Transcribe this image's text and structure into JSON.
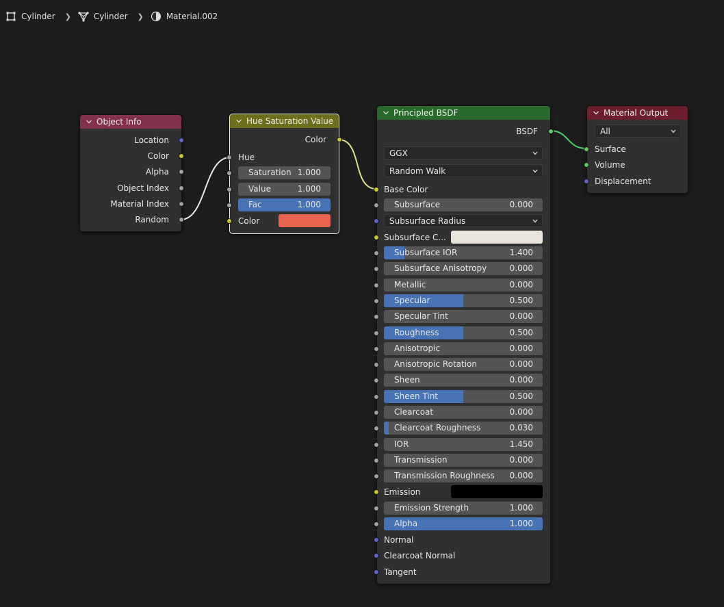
{
  "breadcrumb": {
    "object": "Cylinder",
    "mesh": "Cylinder",
    "material": "Material.002"
  },
  "object_info": {
    "title": "Object Info",
    "header_color": "#83314a",
    "outputs": [
      "Location",
      "Color",
      "Alpha",
      "Object Index",
      "Material Index",
      "Random"
    ]
  },
  "hsv": {
    "title": "Hue Saturation Value",
    "header_color": "#6e6e1d",
    "output": "Color",
    "hue": "Hue",
    "saturation": {
      "label": "Saturation",
      "value": "1.000"
    },
    "value": {
      "label": "Value",
      "value": "1.000"
    },
    "fac": {
      "label": "Fac",
      "value": "1.000",
      "fill": 1.0
    },
    "color_label": "Color",
    "color_swatch": "#e8634e"
  },
  "bsdf": {
    "title": "Principled BSDF",
    "header_color": "#286a2c",
    "output": "BSDF",
    "distribution": "GGX",
    "subsurface_method": "Random Walk",
    "base_color": "Base Color",
    "subsurface": {
      "label": "Subsurface",
      "value": "0.000",
      "fill": 0
    },
    "subsurface_radius": "Subsurface Radius",
    "subsurface_color": {
      "label": "Subsurface C...",
      "swatch": "#e9e4db"
    },
    "params": [
      {
        "label": "Subsurface IOR",
        "value": "1.400",
        "fill": 0.13
      },
      {
        "label": "Subsurface Anisotropy",
        "value": "0.000",
        "fill": 0
      },
      {
        "label": "Metallic",
        "value": "0.000",
        "fill": 0
      },
      {
        "label": "Specular",
        "value": "0.500",
        "fill": 0.5
      },
      {
        "label": "Specular Tint",
        "value": "0.000",
        "fill": 0
      },
      {
        "label": "Roughness",
        "value": "0.500",
        "fill": 0.5
      },
      {
        "label": "Anisotropic",
        "value": "0.000",
        "fill": 0
      },
      {
        "label": "Anisotropic Rotation",
        "value": "0.000",
        "fill": 0
      },
      {
        "label": "Sheen",
        "value": "0.000",
        "fill": 0
      },
      {
        "label": "Sheen Tint",
        "value": "0.500",
        "fill": 0.5
      },
      {
        "label": "Clearcoat",
        "value": "0.000",
        "fill": 0
      },
      {
        "label": "Clearcoat Roughness",
        "value": "0.030",
        "fill": 0.03
      },
      {
        "label": "IOR",
        "value": "1.450",
        "fill": 0
      },
      {
        "label": "Transmission",
        "value": "0.000",
        "fill": 0
      },
      {
        "label": "Transmission Roughness",
        "value": "0.000",
        "fill": 0
      }
    ],
    "emission": {
      "label": "Emission",
      "swatch": "#000000"
    },
    "emission_strength": {
      "label": "Emission Strength",
      "value": "1.000",
      "fill": 0
    },
    "alpha": {
      "label": "Alpha",
      "value": "1.000",
      "fill": 1.0
    },
    "vector_inputs": [
      "Normal",
      "Clearcoat Normal",
      "Tangent"
    ]
  },
  "material_output": {
    "title": "Material Output",
    "header_color": "#6b1f2c",
    "target": "All",
    "inputs": [
      "Surface",
      "Volume",
      "Displacement"
    ]
  },
  "links": {
    "random_to_hue": "#e8e8e8",
    "hsv_color_to_base_color": "#e0e08a",
    "bsdf_to_surface": "#4ccc6b"
  }
}
